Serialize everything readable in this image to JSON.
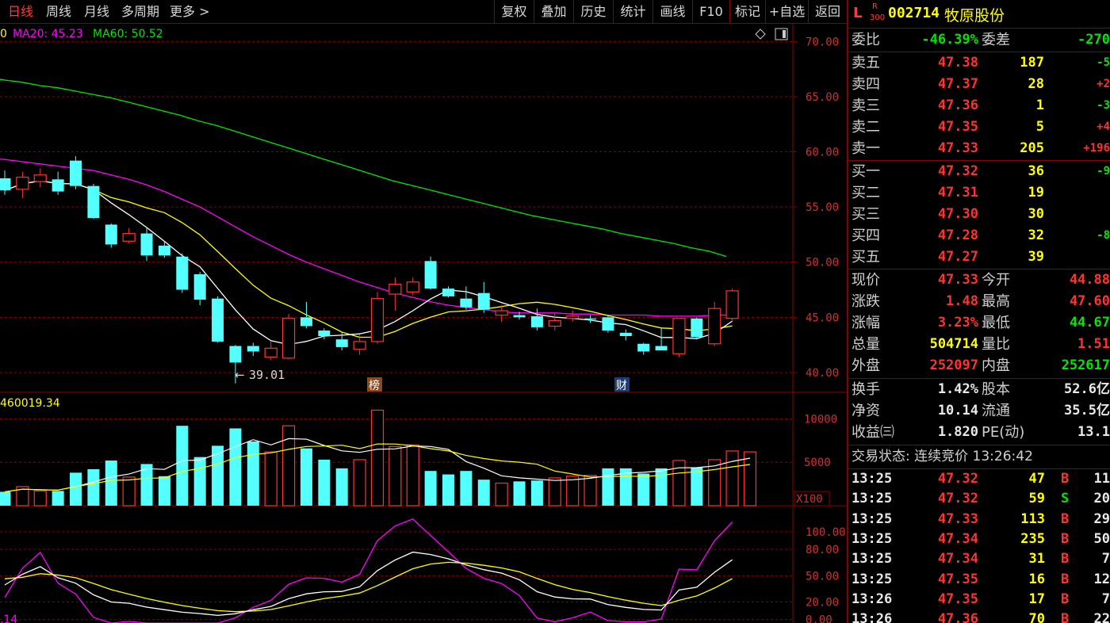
{
  "period_tabs": [
    {
      "label": "日线",
      "active": true
    },
    {
      "label": "周线",
      "active": false
    },
    {
      "label": "月线",
      "active": false
    },
    {
      "label": "多周期",
      "active": false
    },
    {
      "label": "更多 >",
      "active": false
    }
  ],
  "toolbar": [
    "复权",
    "叠加",
    "历史",
    "统计",
    "画线",
    "F10",
    "标记",
    "+自选",
    "返回"
  ],
  "indicators": {
    "ma_prefix": "0",
    "ma20_label": "MA20: 45.23",
    "ma60_label": "MA60: 50.52",
    "volume_label": "460019.34",
    "kdj_label": ".14",
    "volume_unit": "X100",
    "low_marker": "39.01",
    "badge1": "榜",
    "badge2": "财"
  },
  "colors": {
    "up": "#ff3232",
    "down": "#54ffff",
    "ma5": "#ffffff",
    "ma10": "#ffff00",
    "ma20": "#ff00ff",
    "ma60": "#00e600",
    "grid": "#8b0000",
    "axis_text": "#d03030",
    "green_text": "#00e600",
    "yellow_text": "#ffff00"
  },
  "chart_data": {
    "type": "candlestick",
    "price_axis": [
      70.0,
      65.0,
      60.0,
      55.0,
      50.0,
      45.0,
      40.0
    ],
    "price_ylim": [
      38.2,
      71.6
    ],
    "volume_axis": [
      10000,
      5000
    ],
    "volume_ylim": [
      0,
      11500
    ],
    "kdj_axis": [
      100.0,
      80.0,
      50.0,
      20.0,
      0.0
    ],
    "kdj_ylim": [
      -4,
      128
    ],
    "candles": [
      {
        "o": 57.6,
        "c": 56.5,
        "h": 58.3,
        "l": 56.1
      },
      {
        "o": 56.6,
        "c": 57.7,
        "h": 58.2,
        "l": 55.8
      },
      {
        "o": 57.3,
        "c": 57.9,
        "h": 58.5,
        "l": 56.8
      },
      {
        "o": 57.5,
        "c": 56.4,
        "h": 58.2,
        "l": 56.1
      },
      {
        "o": 59.2,
        "c": 56.9,
        "h": 59.6,
        "l": 56.6
      },
      {
        "o": 56.9,
        "c": 54.0,
        "h": 57.1,
        "l": 53.9
      },
      {
        "o": 53.4,
        "c": 51.6,
        "h": 53.5,
        "l": 51.3
      },
      {
        "o": 51.9,
        "c": 52.6,
        "h": 53.1,
        "l": 51.7
      },
      {
        "o": 52.6,
        "c": 50.6,
        "h": 53.2,
        "l": 50.1
      },
      {
        "o": 51.5,
        "c": 50.6,
        "h": 51.9,
        "l": 50.4
      },
      {
        "o": 50.5,
        "c": 47.5,
        "h": 50.8,
        "l": 47.2
      },
      {
        "o": 48.9,
        "c": 46.6,
        "h": 49.1,
        "l": 46.1
      },
      {
        "o": 46.7,
        "c": 42.8,
        "h": 46.9,
        "l": 42.7
      },
      {
        "o": 42.4,
        "c": 40.9,
        "h": 42.5,
        "l": 39.01
      },
      {
        "o": 42.4,
        "c": 41.9,
        "h": 42.7,
        "l": 41.5
      },
      {
        "o": 41.4,
        "c": 42.2,
        "h": 42.8,
        "l": 41.1
      },
      {
        "o": 41.3,
        "c": 44.9,
        "h": 45.3,
        "l": 41.2
      },
      {
        "o": 45.0,
        "c": 44.2,
        "h": 46.4,
        "l": 44.0
      },
      {
        "o": 43.8,
        "c": 43.3,
        "h": 44.0,
        "l": 43.0
      },
      {
        "o": 43.0,
        "c": 42.3,
        "h": 43.6,
        "l": 42.0
      },
      {
        "o": 42.1,
        "c": 42.8,
        "h": 43.4,
        "l": 41.6
      },
      {
        "o": 42.8,
        "c": 46.7,
        "h": 47.3,
        "l": 42.6
      },
      {
        "o": 47.1,
        "c": 48.0,
        "h": 48.6,
        "l": 45.6
      },
      {
        "o": 47.3,
        "c": 48.2,
        "h": 48.6,
        "l": 47.0
      },
      {
        "o": 50.1,
        "c": 47.6,
        "h": 50.5,
        "l": 47.5
      },
      {
        "o": 47.6,
        "c": 46.9,
        "h": 47.8,
        "l": 46.8
      },
      {
        "o": 46.7,
        "c": 45.9,
        "h": 47.8,
        "l": 45.7
      },
      {
        "o": 47.2,
        "c": 45.7,
        "h": 48.2,
        "l": 45.4
      },
      {
        "o": 45.2,
        "c": 45.6,
        "h": 46.1,
        "l": 44.6
      },
      {
        "o": 45.2,
        "c": 45.0,
        "h": 45.5,
        "l": 44.8
      },
      {
        "o": 45.1,
        "c": 44.1,
        "h": 45.8,
        "l": 43.8
      },
      {
        "o": 44.2,
        "c": 44.7,
        "h": 45.4,
        "l": 43.8
      },
      {
        "o": 44.9,
        "c": 45.1,
        "h": 45.6,
        "l": 44.6
      },
      {
        "o": 44.9,
        "c": 44.8,
        "h": 45.2,
        "l": 44.5
      },
      {
        "o": 45.0,
        "c": 43.8,
        "h": 45.2,
        "l": 43.6
      },
      {
        "o": 43.6,
        "c": 43.3,
        "h": 43.9,
        "l": 42.9
      },
      {
        "o": 42.6,
        "c": 41.9,
        "h": 42.7,
        "l": 41.6
      },
      {
        "o": 42.4,
        "c": 42.0,
        "h": 44.0,
        "l": 42.0
      },
      {
        "o": 41.7,
        "c": 44.9,
        "h": 44.9,
        "l": 41.4
      },
      {
        "o": 44.9,
        "c": 43.2,
        "h": 45.0,
        "l": 43.0
      },
      {
        "o": 42.6,
        "c": 45.8,
        "h": 46.4,
        "l": 42.4
      },
      {
        "o": 44.9,
        "c": 47.4,
        "h": 47.6,
        "l": 44.7
      }
    ],
    "volume": [
      16,
      22,
      17,
      17,
      38,
      42,
      52,
      33,
      48,
      34,
      92,
      56,
      69,
      89,
      74,
      62,
      92,
      66,
      53,
      43,
      53,
      110,
      68,
      70,
      40,
      36,
      40,
      30,
      26,
      28,
      29,
      32,
      34,
      35,
      43,
      43,
      37,
      43,
      52,
      44,
      53,
      63,
      62
    ],
    "volume_up": [
      false,
      true,
      true,
      false,
      false,
      false,
      false,
      true,
      false,
      false,
      false,
      false,
      false,
      false,
      false,
      true,
      true,
      false,
      false,
      false,
      true,
      true,
      true,
      true,
      false,
      false,
      false,
      false,
      true,
      false,
      false,
      true,
      true,
      true,
      false,
      false,
      false,
      false,
      true,
      false,
      true,
      true,
      true
    ],
    "ma20_line": [
      59.3,
      59.1,
      58.9,
      58.7,
      58.5,
      58.3,
      57.9,
      57.5,
      57.0,
      56.4,
      55.7,
      55.0,
      54.1,
      53.2,
      52.3,
      51.5,
      50.7,
      50.0,
      49.4,
      48.8,
      48.2,
      47.7,
      47.2,
      46.8,
      46.4,
      46.1,
      45.9,
      45.7,
      45.5,
      45.4,
      45.4,
      45.4,
      45.3,
      45.3,
      45.2,
      45.2,
      45.2,
      45.1,
      45.1,
      45.1,
      45.2,
      45.2
    ],
    "ma60_line": [
      66.5,
      66.3,
      66.0,
      65.8,
      65.5,
      65.2,
      64.9,
      64.5,
      64.1,
      63.7,
      63.3,
      62.8,
      62.4,
      61.9,
      61.4,
      60.9,
      60.4,
      59.9,
      59.4,
      58.9,
      58.4,
      57.9,
      57.4,
      57.0,
      56.6,
      56.2,
      55.8,
      55.4,
      55.0,
      54.6,
      54.2,
      53.9,
      53.6,
      53.3,
      53.0,
      52.6,
      52.3,
      52.0,
      51.7,
      51.3,
      51.0,
      50.52
    ]
  },
  "stock": {
    "prefix": "L",
    "badge_top": "R",
    "badge_bottom": "300",
    "code": "002714",
    "name": "牧原股份"
  },
  "weibi": {
    "label1": "委比",
    "val1": "-46.39%",
    "label2": "委差",
    "val2": "-270"
  },
  "asks": [
    {
      "label": "卖五",
      "price": "47.38",
      "vol": "187",
      "chg": "-5"
    },
    {
      "label": "卖四",
      "price": "47.37",
      "vol": "28",
      "chg": "+2"
    },
    {
      "label": "卖三",
      "price": "47.36",
      "vol": "1",
      "chg": "-3"
    },
    {
      "label": "卖二",
      "price": "47.35",
      "vol": "5",
      "chg": "+4"
    },
    {
      "label": "卖一",
      "price": "47.33",
      "vol": "205",
      "chg": "+196"
    }
  ],
  "bids": [
    {
      "label": "买一",
      "price": "47.32",
      "vol": "36",
      "chg": "-9"
    },
    {
      "label": "买二",
      "price": "47.31",
      "vol": "19",
      "chg": ""
    },
    {
      "label": "买三",
      "price": "47.30",
      "vol": "30",
      "chg": ""
    },
    {
      "label": "买四",
      "price": "47.28",
      "vol": "32",
      "chg": "-8"
    },
    {
      "label": "买五",
      "price": "47.27",
      "vol": "39",
      "chg": ""
    }
  ],
  "quote": [
    {
      "l1": "现价",
      "v1": "47.33",
      "c1": "red",
      "l2": "今开",
      "v2": "44.88",
      "c2": "red"
    },
    {
      "l1": "涨跌",
      "v1": "1.48",
      "c1": "red",
      "l2": "最高",
      "v2": "47.60",
      "c2": "red"
    },
    {
      "l1": "涨幅",
      "v1": "3.23%",
      "c1": "red",
      "l2": "最低",
      "v2": "44.67",
      "c2": "green"
    },
    {
      "l1": "总量",
      "v1": "504714",
      "c1": "yellow",
      "l2": "量比",
      "v2": "1.51",
      "c2": "red"
    },
    {
      "l1": "外盘",
      "v1": "252097",
      "c1": "red",
      "l2": "内盘",
      "v2": "252617",
      "c2": "green"
    }
  ],
  "fundamentals": [
    {
      "l1": "换手",
      "v1": "1.42%",
      "l2": "股本",
      "v2": "52.6亿"
    },
    {
      "l1": "净资",
      "v1": "10.14",
      "l2": "流通",
      "v2": "35.5亿"
    },
    {
      "l1": "收益㈢",
      "v1": "1.820",
      "l2": "PE(动)",
      "v2": "13.1"
    }
  ],
  "trade_status": "交易状态: 连续竞价 13:26:42",
  "ticks": [
    {
      "time": "13:25",
      "price": "47.32",
      "vol": "47",
      "side": "B",
      "n": "11"
    },
    {
      "time": "13:25",
      "price": "47.32",
      "vol": "59",
      "side": "S",
      "n": "20"
    },
    {
      "time": "13:25",
      "price": "47.33",
      "vol": "113",
      "side": "B",
      "n": "29"
    },
    {
      "time": "13:25",
      "price": "47.34",
      "vol": "235",
      "side": "B",
      "n": "50"
    },
    {
      "time": "13:25",
      "price": "47.34",
      "vol": "31",
      "side": "B",
      "n": "7"
    },
    {
      "time": "13:25",
      "price": "47.35",
      "vol": "16",
      "side": "B",
      "n": "12"
    },
    {
      "time": "13:26",
      "price": "47.35",
      "vol": "17",
      "side": "B",
      "n": "7"
    },
    {
      "time": "13:26",
      "price": "47.36",
      "vol": "70",
      "side": "B",
      "n": "22"
    }
  ]
}
